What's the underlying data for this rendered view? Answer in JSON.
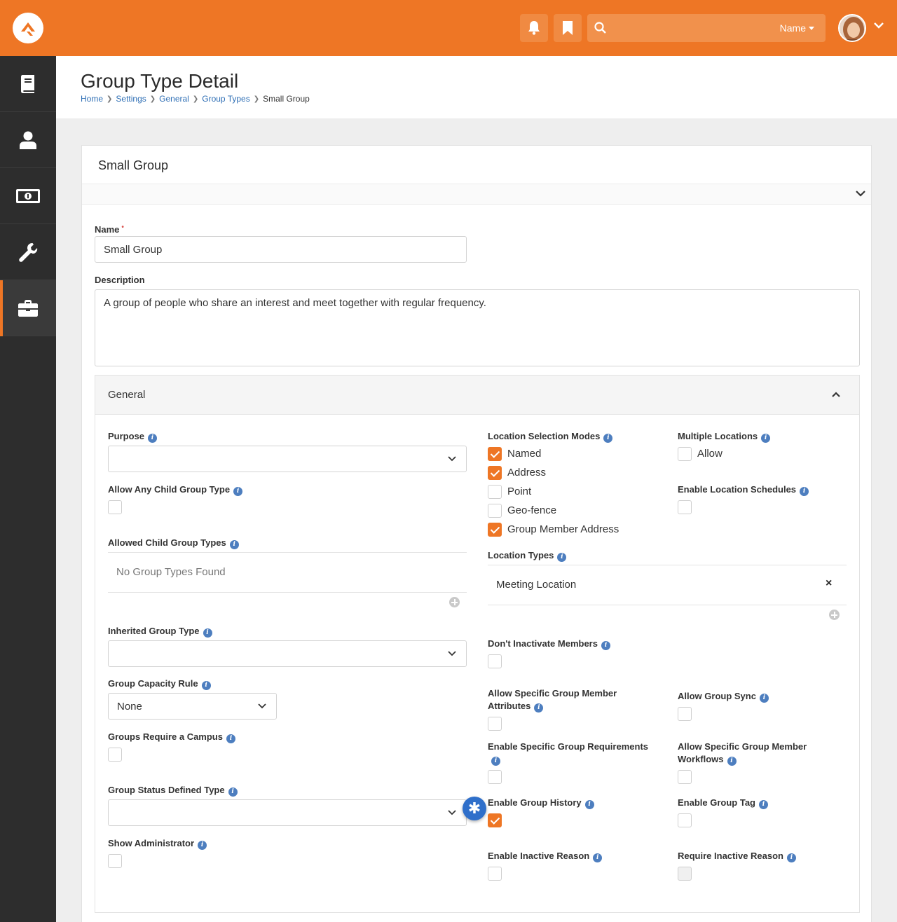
{
  "topbar": {
    "search_scope": "Name",
    "search_placeholder": ""
  },
  "sidebar": {
    "items": [
      {
        "icon": "book-icon"
      },
      {
        "icon": "person-icon"
      },
      {
        "icon": "money-icon"
      },
      {
        "icon": "wrench-icon"
      },
      {
        "icon": "briefcase-icon",
        "active": true
      }
    ]
  },
  "header": {
    "title": "Group Type Detail",
    "breadcrumb": [
      "Home",
      "Settings",
      "General",
      "Group Types",
      "Small Group"
    ]
  },
  "panel": {
    "title": "Small Group",
    "name_label": "Name",
    "name_value": "Small Group",
    "description_label": "Description",
    "description_value": "A group of people who share an interest and meet together with regular frequency."
  },
  "general": {
    "title": "General",
    "purpose_label": "Purpose",
    "purpose_value": "",
    "allow_any_child_label": "Allow Any Child Group Type",
    "allowed_child_label": "Allowed Child Group Types",
    "allowed_child_empty": "No Group Types Found",
    "inherited_label": "Inherited Group Type",
    "inherited_value": "",
    "capacity_label": "Group Capacity Rule",
    "capacity_value": "None",
    "require_campus_label": "Groups Require a Campus",
    "status_defined_label": "Group Status Defined Type",
    "status_defined_value": "",
    "show_admin_label": "Show Administrator",
    "location_modes_label": "Location Selection Modes",
    "location_modes": [
      {
        "label": "Named",
        "checked": true
      },
      {
        "label": "Address",
        "checked": true
      },
      {
        "label": "Point",
        "checked": false
      },
      {
        "label": "Geo-fence",
        "checked": false
      },
      {
        "label": "Group Member Address",
        "checked": true
      }
    ],
    "multiple_locations_label": "Multiple Locations",
    "multiple_locations_option": "Allow",
    "location_schedules_label": "Enable Location Schedules",
    "location_types_label": "Location Types",
    "location_types_items": [
      "Meeting Location"
    ],
    "dont_inactivate_label": "Don't Inactivate Members",
    "specific_attributes_label": "Allow Specific Group Member Attributes",
    "group_sync_label": "Allow Group Sync",
    "specific_requirements_label": "Enable Specific Group Requirements",
    "specific_workflows_label": "Allow Specific Group Member Workflows",
    "group_history_label": "Enable Group History",
    "group_tag_label": "Enable Group Tag",
    "inactive_reason_label": "Enable Inactive Reason",
    "require_inactive_reason_label": "Require Inactive Reason",
    "remove_symbol": "×",
    "required_marker": "•"
  },
  "colors": {
    "brand": "#ee7625",
    "sidebar": "#2d2d2d",
    "link": "#2f6fb5",
    "info": "#4d7ebf"
  }
}
